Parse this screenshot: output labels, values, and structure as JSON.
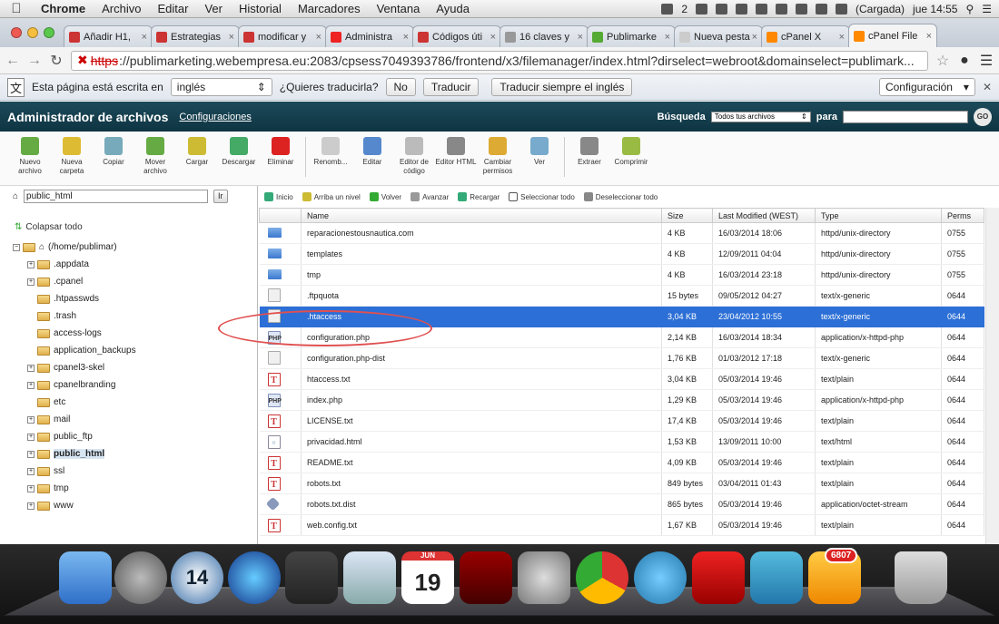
{
  "menubar": {
    "app": "Chrome",
    "items": [
      "Archivo",
      "Editar",
      "Ver",
      "Historial",
      "Marcadores",
      "Ventana",
      "Ayuda"
    ],
    "status": [
      "2",
      "(Cargada)",
      "jue 14:55"
    ]
  },
  "tabs": [
    {
      "label": "Añadir H1,",
      "icon_color": "#c33"
    },
    {
      "label": "Estrategias",
      "icon_color": "#c33"
    },
    {
      "label": "modificar y",
      "icon_color": "#c33"
    },
    {
      "label": "Administra",
      "icon_color": "#e22"
    },
    {
      "label": "Códigos úti",
      "icon_color": "#c33"
    },
    {
      "label": "16 claves y",
      "icon_color": "#999"
    },
    {
      "label": "Publimarke",
      "icon_color": "#5a3"
    },
    {
      "label": "Nueva pestaña",
      "icon_color": "#ccc"
    },
    {
      "label": "cPanel X",
      "icon_color": "#f80"
    },
    {
      "label": "cPanel File",
      "icon_color": "#f80",
      "active": true
    }
  ],
  "url": {
    "scheme": "https",
    "rest": "://publimarketing.webempresa.eu:2083/cpsess7049393786/frontend/x3/filemanager/index.html?dirselect=webroot&domainselect=publimark..."
  },
  "translate": {
    "prefix": "Esta página está escrita en",
    "language": "inglés",
    "question": "¿Quieres traducirla?",
    "no": "No",
    "translate": "Traducir",
    "always": "Traducir siempre el inglés",
    "config": "Configuración"
  },
  "cpanel": {
    "title": "Administrador de archivos",
    "settings": "Configuraciones",
    "search_label": "Búsqueda",
    "search_scope": "Todos tus archivos",
    "para": "para",
    "go": "GO"
  },
  "tools": [
    {
      "label": "Nuevo archivo",
      "color": "#6a4"
    },
    {
      "label": "Nueva carpeta",
      "color": "#db3"
    },
    {
      "label": "Copiar",
      "color": "#7ab"
    },
    {
      "label": "Mover archivo",
      "color": "#6a4"
    },
    {
      "label": "Cargar",
      "color": "#cb3"
    },
    {
      "label": "Descargar",
      "color": "#4a6"
    },
    {
      "label": "Eliminar",
      "color": "#d22"
    },
    {
      "label": "Renomb...",
      "color": "#ccc"
    },
    {
      "label": "Editar",
      "color": "#58c"
    },
    {
      "label": "Editor de código",
      "color": "#bbb"
    },
    {
      "label": "Editor HTML",
      "color": "#888"
    },
    {
      "label": "Cambiar permisos",
      "color": "#da3"
    },
    {
      "label": "Ver",
      "color": "#7ac"
    },
    {
      "label": "Extraer",
      "color": "#888"
    },
    {
      "label": "Comprimir",
      "color": "#9b4"
    }
  ],
  "left": {
    "path": "public_html",
    "go": "Ir",
    "collapse": "Colapsar todo",
    "root": "(/home/publimar)",
    "tree": [
      {
        "label": ".appdata",
        "exp": true
      },
      {
        "label": ".cpanel",
        "exp": true
      },
      {
        "label": ".htpasswds",
        "exp": false
      },
      {
        "label": ".trash",
        "exp": false
      },
      {
        "label": "access-logs",
        "exp": false
      },
      {
        "label": "application_backups",
        "exp": false
      },
      {
        "label": "cpanel3-skel",
        "exp": true
      },
      {
        "label": "cpanelbranding",
        "exp": true
      },
      {
        "label": "etc",
        "exp": false
      },
      {
        "label": "mail",
        "exp": true
      },
      {
        "label": "public_ftp",
        "exp": true
      },
      {
        "label": "public_html",
        "exp": true,
        "selected": true
      },
      {
        "label": "ssl",
        "exp": true
      },
      {
        "label": "tmp",
        "exp": true
      },
      {
        "label": "www",
        "exp": true
      }
    ]
  },
  "nav": [
    "Inicio",
    "Arriba un nivel",
    "Volver",
    "Avanzar",
    "Recargar",
    "Seleccionar todo",
    "Deseleccionar todo"
  ],
  "columns": [
    "Name",
    "Size",
    "Last Modified (WEST)",
    "Type",
    "Perms"
  ],
  "files": [
    {
      "icon": "dir",
      "name": "reparacionestousnautica.com",
      "size": "4 KB",
      "modified": "16/03/2014 18:06",
      "type": "httpd/unix-directory",
      "perms": "0755"
    },
    {
      "icon": "dir",
      "name": "templates",
      "size": "4 KB",
      "modified": "12/09/2011 04:04",
      "type": "httpd/unix-directory",
      "perms": "0755"
    },
    {
      "icon": "dir",
      "name": "tmp",
      "size": "4 KB",
      "modified": "16/03/2014 23:18",
      "type": "httpd/unix-directory",
      "perms": "0755"
    },
    {
      "icon": "gen",
      "name": ".ftpquota",
      "size": "15 bytes",
      "modified": "09/05/2012 04:27",
      "type": "text/x-generic",
      "perms": "0644"
    },
    {
      "icon": "gen",
      "name": ".htaccess",
      "size": "3,04 KB",
      "modified": "23/04/2012 10:55",
      "type": "text/x-generic",
      "perms": "0644",
      "selected": true
    },
    {
      "icon": "php",
      "name": "configuration.php",
      "size": "2,14 KB",
      "modified": "16/03/2014 18:34",
      "type": "application/x-httpd-php",
      "perms": "0644"
    },
    {
      "icon": "gen",
      "name": "configuration.php-dist",
      "size": "1,76 KB",
      "modified": "01/03/2012 17:18",
      "type": "text/x-generic",
      "perms": "0644"
    },
    {
      "icon": "txt",
      "name": "htaccess.txt",
      "size": "3,04 KB",
      "modified": "05/03/2014 19:46",
      "type": "text/plain",
      "perms": "0644"
    },
    {
      "icon": "php",
      "name": "index.php",
      "size": "1,29 KB",
      "modified": "05/03/2014 19:46",
      "type": "application/x-httpd-php",
      "perms": "0644"
    },
    {
      "icon": "txt",
      "name": "LICENSE.txt",
      "size": "17,4 KB",
      "modified": "05/03/2014 19:46",
      "type": "text/plain",
      "perms": "0644"
    },
    {
      "icon": "html",
      "name": "privacidad.html",
      "size": "1,53 KB",
      "modified": "13/09/2011 10:00",
      "type": "text/html",
      "perms": "0644"
    },
    {
      "icon": "txt",
      "name": "README.txt",
      "size": "4,09 KB",
      "modified": "05/03/2014 19:46",
      "type": "text/plain",
      "perms": "0644"
    },
    {
      "icon": "txt",
      "name": "robots.txt",
      "size": "849 bytes",
      "modified": "03/04/2011 01:43",
      "type": "text/plain",
      "perms": "0644"
    },
    {
      "icon": "oct",
      "name": "robots.txt.dist",
      "size": "865 bytes",
      "modified": "05/03/2014 19:46",
      "type": "application/octet-stream",
      "perms": "0644"
    },
    {
      "icon": "txt",
      "name": "web.config.txt",
      "size": "1,67 KB",
      "modified": "05/03/2014 19:46",
      "type": "text/plain",
      "perms": "0644"
    }
  ],
  "dock": {
    "calendar_month": "JUN",
    "calendar_day": "19",
    "clock": "14",
    "badge": "6807"
  }
}
